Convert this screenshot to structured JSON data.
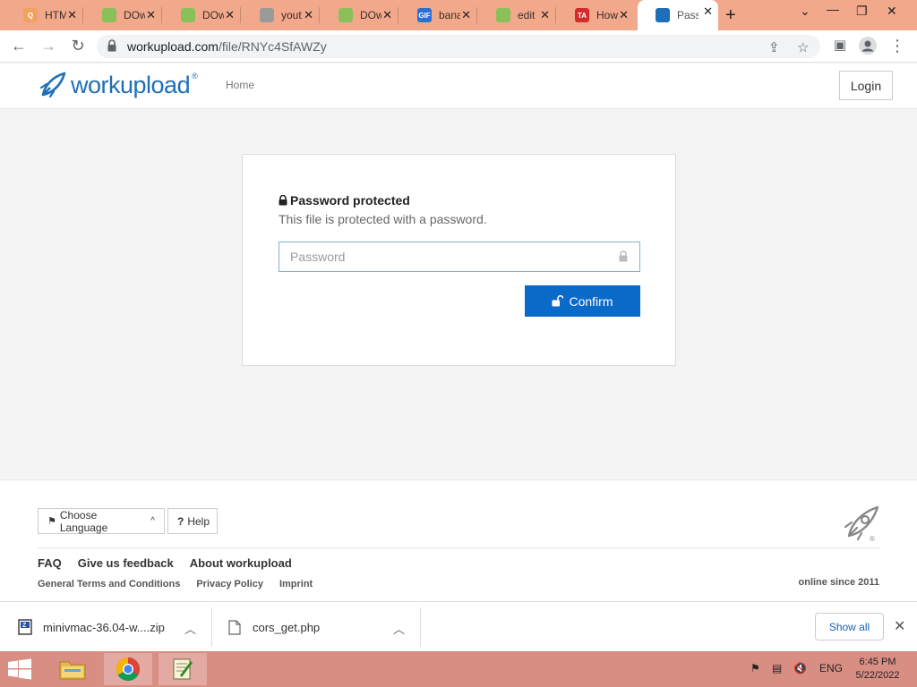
{
  "browser": {
    "tabs": [
      {
        "title": "HTM",
        "favicon_color": "#f0a35e",
        "favicon_glyph": "Q"
      },
      {
        "title": "DOw",
        "favicon_color": "#8bbf5a",
        "favicon_glyph": ""
      },
      {
        "title": "DOw",
        "favicon_color": "#8bbf5a",
        "favicon_glyph": ""
      },
      {
        "title": "yout",
        "favicon_color": "#9a9a9a",
        "favicon_glyph": ""
      },
      {
        "title": "DOw",
        "favicon_color": "#8bbf5a",
        "favicon_glyph": ""
      },
      {
        "title": "bana",
        "favicon_color": "#2a6fd1",
        "favicon_glyph": "GIF"
      },
      {
        "title": "edit",
        "favicon_color": "#8bbf5a",
        "favicon_glyph": ""
      },
      {
        "title": "How",
        "favicon_color": "#d42a2a",
        "favicon_glyph": "TA"
      },
      {
        "title": "Pass",
        "favicon_color": "#1e6fb8",
        "favicon_glyph": ""
      }
    ],
    "active_tab_index": 8,
    "url_host": "workupload.com",
    "url_path": "/file/RNYc4SfAWZy"
  },
  "site": {
    "logo_text": "workupload",
    "logo_reg": "®",
    "nav_home": "Home",
    "login": "Login"
  },
  "card": {
    "title": "Password protected",
    "subtitle": "This file is protected with a password.",
    "password_placeholder": "Password",
    "confirm": "Confirm"
  },
  "footer": {
    "language_button": "Choose Language",
    "help_button": "Help",
    "links": [
      "FAQ",
      "Give us feedback",
      "About workupload"
    ],
    "small_links": [
      "General Terms and Conditions",
      "Privacy Policy",
      "Imprint"
    ],
    "online_since": "online since 2011"
  },
  "downloads": {
    "items": [
      {
        "name": "minivmac-36.04-w....zip",
        "icon": "zip-icon"
      },
      {
        "name": "cors_get.php",
        "icon": "file-icon"
      }
    ],
    "show_all": "Show all"
  },
  "taskbar": {
    "lang": "ENG",
    "time": "6:45 PM",
    "date": "5/22/2022"
  },
  "colors": {
    "tabstrip": "#f2a98b",
    "brand": "#1e6fb8",
    "confirm": "#0a6ac8",
    "taskbar": "#d98e83"
  }
}
